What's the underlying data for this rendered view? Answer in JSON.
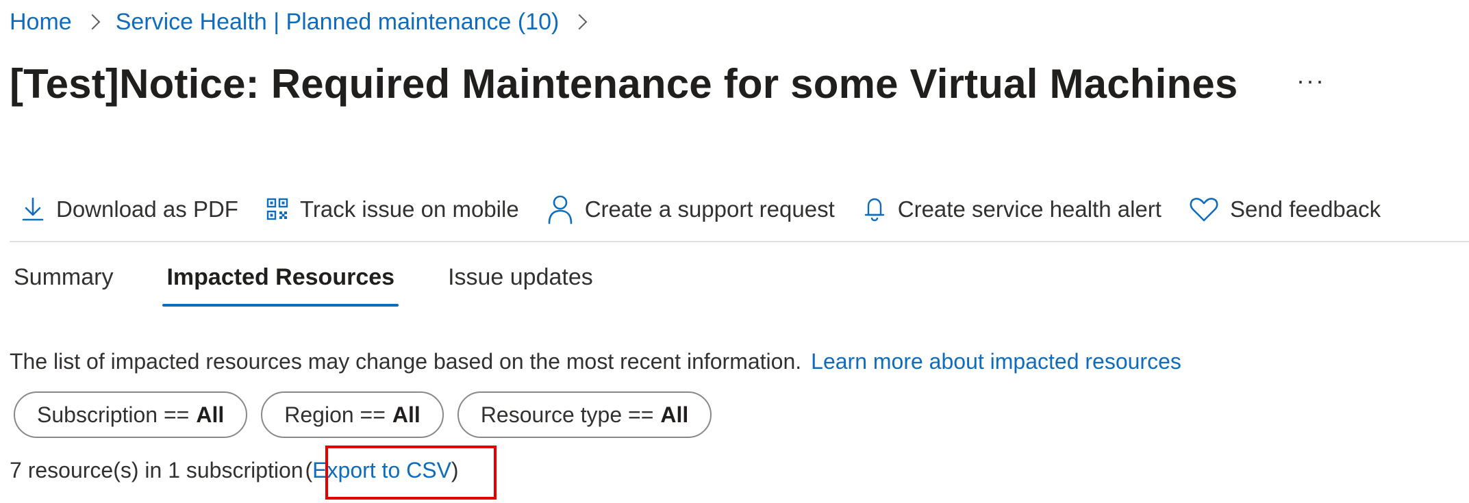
{
  "breadcrumb": {
    "items": [
      "Home",
      "Service Health | Planned maintenance (10)"
    ]
  },
  "page": {
    "title": "[Test]Notice: Required Maintenance for some Virtual Machines",
    "more_label": "···"
  },
  "toolbar": {
    "items": [
      {
        "label": "Download as PDF",
        "icon": "download-icon"
      },
      {
        "label": "Track issue on mobile",
        "icon": "qr-code-icon"
      },
      {
        "label": "Create a support request",
        "icon": "person-icon"
      },
      {
        "label": "Create service health alert",
        "icon": "bell-icon"
      },
      {
        "label": "Send feedback",
        "icon": "heart-icon"
      }
    ]
  },
  "tabs": [
    {
      "label": "Summary",
      "active": false
    },
    {
      "label": "Impacted Resources",
      "active": true
    },
    {
      "label": "Issue updates",
      "active": false
    }
  ],
  "info": {
    "text": "The list of impacted resources may change based on the most recent information.",
    "link": "Learn more about impacted resources"
  },
  "filters": [
    {
      "label": "Subscription ==",
      "value": "All"
    },
    {
      "label": "Region ==",
      "value": "All"
    },
    {
      "label": "Resource type ==",
      "value": "All"
    }
  ],
  "summary": {
    "count_text": "7 resource(s) in 1 subscription",
    "open_paren": "(",
    "export_link": "Export to CSV",
    "close_paren": ")"
  },
  "colors": {
    "accent": "#0f6cbd",
    "highlight_box": "#e50000"
  }
}
